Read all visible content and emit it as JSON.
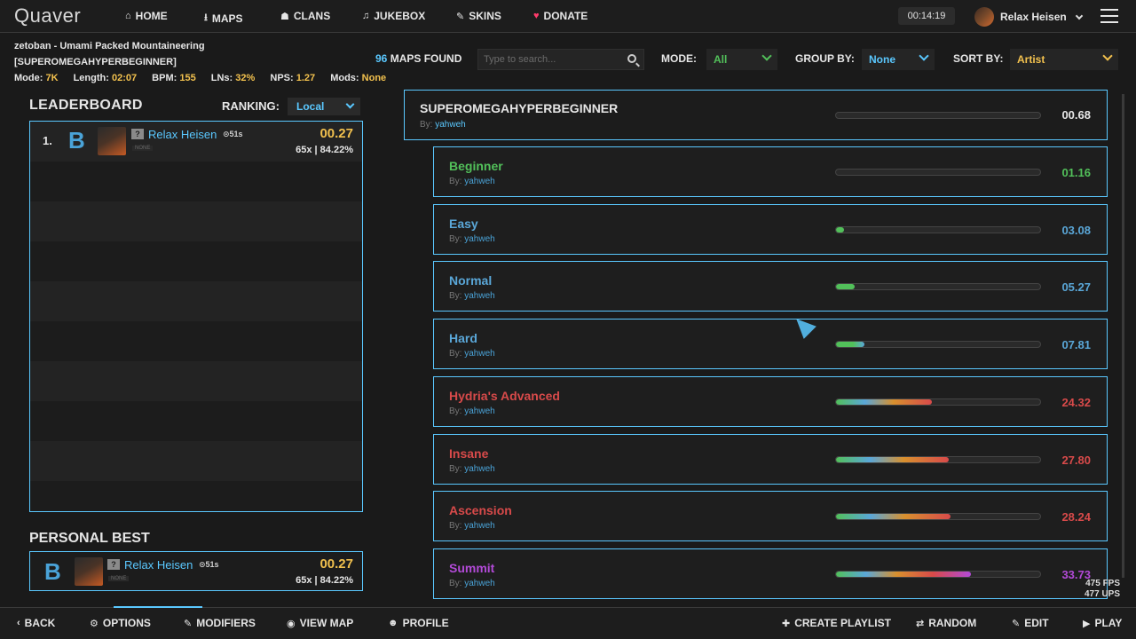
{
  "nav": {
    "logo": "Quaver",
    "items": [
      {
        "icon": "⌂",
        "label": "HOME"
      },
      {
        "icon": "⭳",
        "label": "MAPS"
      },
      {
        "icon": "☗",
        "label": "CLANS"
      },
      {
        "icon": "♫",
        "label": "JUKEBOX"
      },
      {
        "icon": "✎",
        "label": "SKINS"
      },
      {
        "icon": "♥",
        "label": "DONATE"
      }
    ],
    "clock": "00:14:19",
    "username": "Relax Heisen"
  },
  "map_info": {
    "title": "zetoban - Umami Packed Mountaineering",
    "difficulty": "[SUPEROMEGAHYPERBEGINNER]",
    "mode_label": "Mode:",
    "mode": "7K",
    "length_label": "Length:",
    "length": "02:07",
    "bpm_label": "BPM:",
    "bpm": "155",
    "lns_label": "LNs:",
    "lns": "32%",
    "nps_label": "NPS:",
    "nps": "1.27",
    "mods_label": "Mods:",
    "mods": "None"
  },
  "filters": {
    "maps_found_count": "96",
    "maps_found_label": "MAPS FOUND",
    "search_placeholder": "Type to search...",
    "mode_label": "MODE:",
    "mode_value": "All",
    "group_label": "GROUP BY:",
    "group_value": "None",
    "sort_label": "SORT BY:",
    "sort_value": "Artist"
  },
  "leaderboard": {
    "title": "LEADERBOARD",
    "ranking_label": "RANKING:",
    "ranking_value": "Local",
    "scores": [
      {
        "rank": "1.",
        "grade": "B",
        "name": "Relax Heisen",
        "time": "⊙51s",
        "mods": "NONE",
        "score": "00.27",
        "combo_acc": "65x | 84.22%"
      }
    ]
  },
  "personal_best": {
    "title": "PERSONAL BEST",
    "grade": "B",
    "name": "Relax Heisen",
    "time": "⊙51s",
    "mods": "NONE",
    "score": "00.27",
    "combo_acc": "65x | 84.22%"
  },
  "mapset": {
    "title": "SUPEROMEGAHYPERBEGINNER",
    "by_label": "By:",
    "creator": "yahweh",
    "rating": "00.68"
  },
  "difficulties": [
    {
      "name": "Beginner",
      "creator": "yahweh",
      "rating": "01.16",
      "color": "#52c05a",
      "fill": 0.0
    },
    {
      "name": "Easy",
      "creator": "yahweh",
      "rating": "03.08",
      "color": "#5aa7d8",
      "fill": 0.04
    },
    {
      "name": "Normal",
      "creator": "yahweh",
      "rating": "05.27",
      "color": "#5aa7d8",
      "fill": 0.09
    },
    {
      "name": "Hard",
      "creator": "yahweh",
      "rating": "07.81",
      "color": "#5aa7d8",
      "fill": 0.14
    },
    {
      "name": "Hydria's Advanced",
      "creator": "yahweh",
      "rating": "24.32",
      "color": "#d84a4a",
      "fill": 0.47
    },
    {
      "name": "Insane",
      "creator": "yahweh",
      "rating": "27.80",
      "color": "#d84a4a",
      "fill": 0.55
    },
    {
      "name": "Ascension",
      "creator": "yahweh",
      "rating": "28.24",
      "color": "#d84a4a",
      "fill": 0.56
    },
    {
      "name": "Summit",
      "creator": "yahweh",
      "rating": "33.73",
      "color": "#b34ad8",
      "fill": 0.66
    }
  ],
  "perf": {
    "fps": "475 FPS",
    "ups": "477 UPS"
  },
  "bottom": {
    "back": "BACK",
    "options": "OPTIONS",
    "modifiers": "MODIFIERS",
    "view_map": "VIEW MAP",
    "profile": "PROFILE",
    "create_playlist": "CREATE PLAYLIST",
    "random": "RANDOM",
    "edit": "EDIT",
    "play": "PLAY"
  }
}
